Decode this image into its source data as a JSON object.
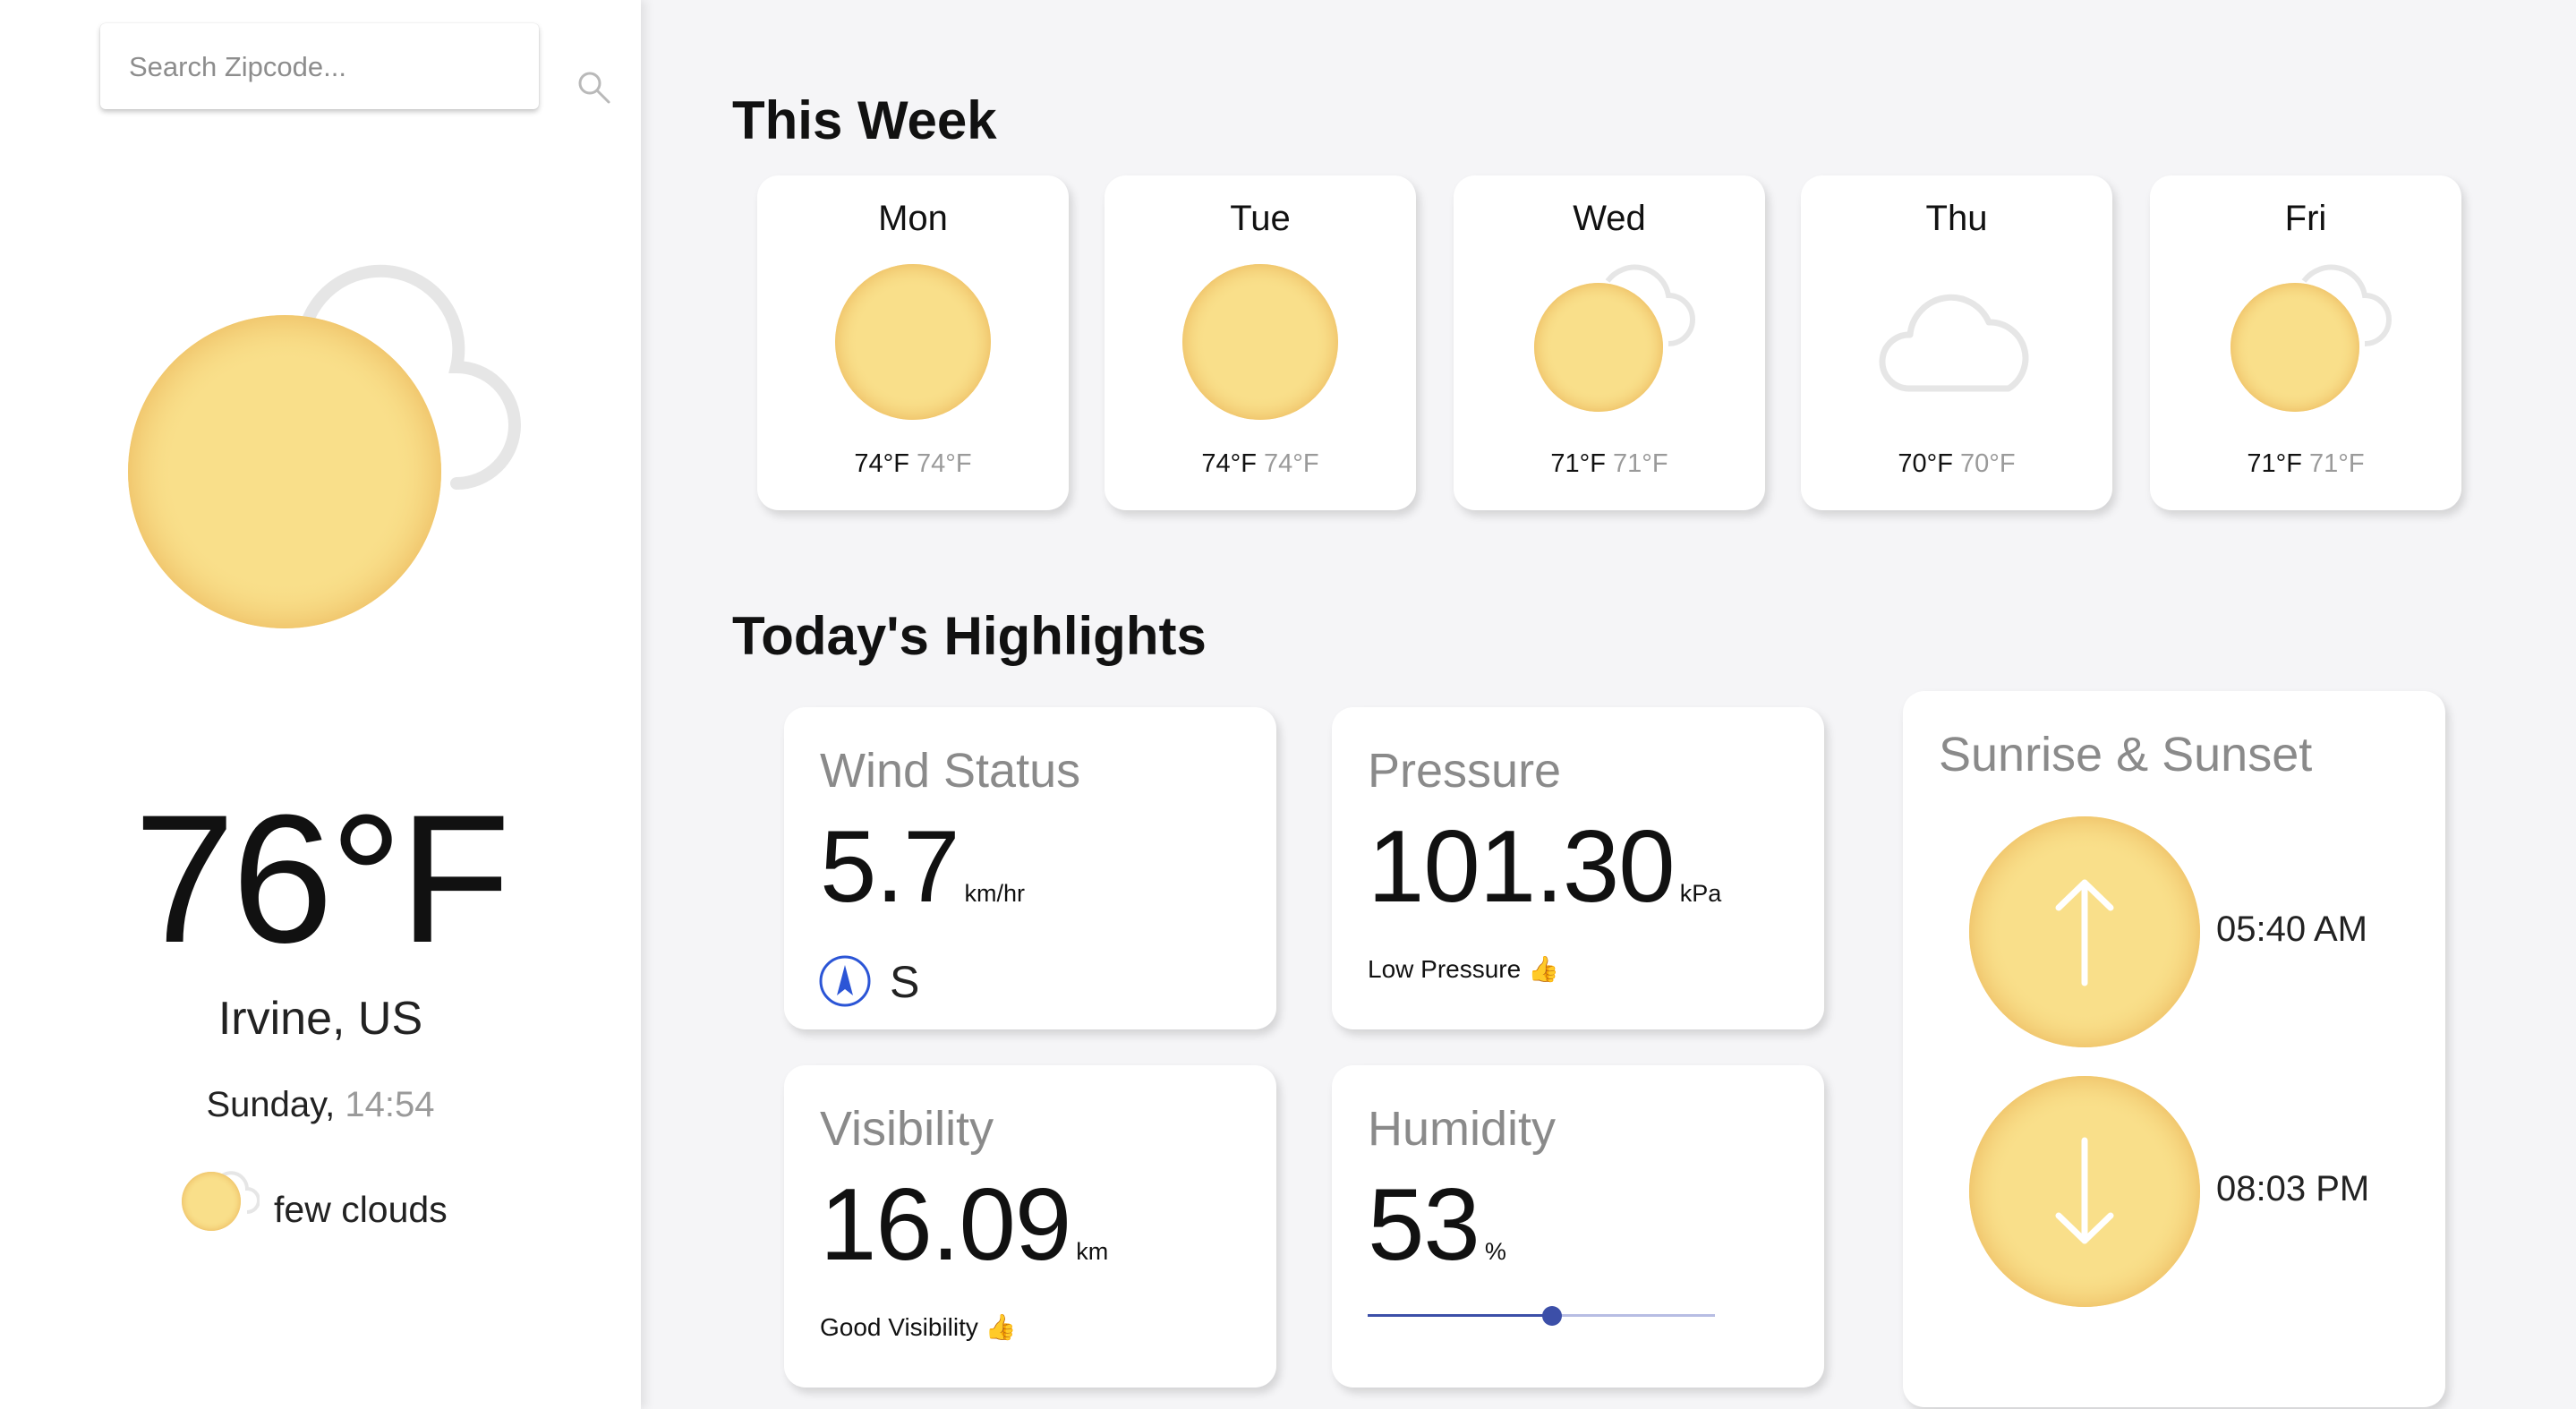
{
  "search": {
    "placeholder": "Search Zipcode..."
  },
  "current": {
    "temperature": "76°F",
    "location": "Irvine, US",
    "day": "Sunday,",
    "time": "14:54",
    "condition": "few clouds",
    "icon": "sun-cloud-icon"
  },
  "week": {
    "heading": "This Week",
    "days": [
      {
        "name": "Mon",
        "high": "74°F",
        "low": "74°F",
        "icon": "sun-icon"
      },
      {
        "name": "Tue",
        "high": "74°F",
        "low": "74°F",
        "icon": "sun-icon"
      },
      {
        "name": "Wed",
        "high": "71°F",
        "low": "71°F",
        "icon": "sun-cloud-icon"
      },
      {
        "name": "Thu",
        "high": "70°F",
        "low": "70°F",
        "icon": "cloud-icon"
      },
      {
        "name": "Fri",
        "high": "71°F",
        "low": "71°F",
        "icon": "sun-cloud-icon"
      }
    ]
  },
  "highlights": {
    "heading": "Today's Highlights",
    "wind": {
      "title": "Wind Status",
      "value": "5.7",
      "unit": "km/hr",
      "direction": "S"
    },
    "pressure": {
      "title": "Pressure",
      "value": "101.30",
      "unit": "kPa",
      "note": "Low Pressure 👍"
    },
    "visibility": {
      "title": "Visibility",
      "value": "16.09",
      "unit": "km",
      "note": "Good Visibility 👍"
    },
    "humidity": {
      "title": "Humidity",
      "value": "53",
      "unit": "%",
      "level": 0.53
    },
    "sun": {
      "title": "Sunrise & Sunset",
      "sunrise": "05:40 AM",
      "sunset": "08:03 PM"
    }
  },
  "colors": {
    "sun": "#f9df8a",
    "cloud": "#e6e6e6",
    "accent": "#3c4fa8",
    "compass": "#2b55d6"
  }
}
